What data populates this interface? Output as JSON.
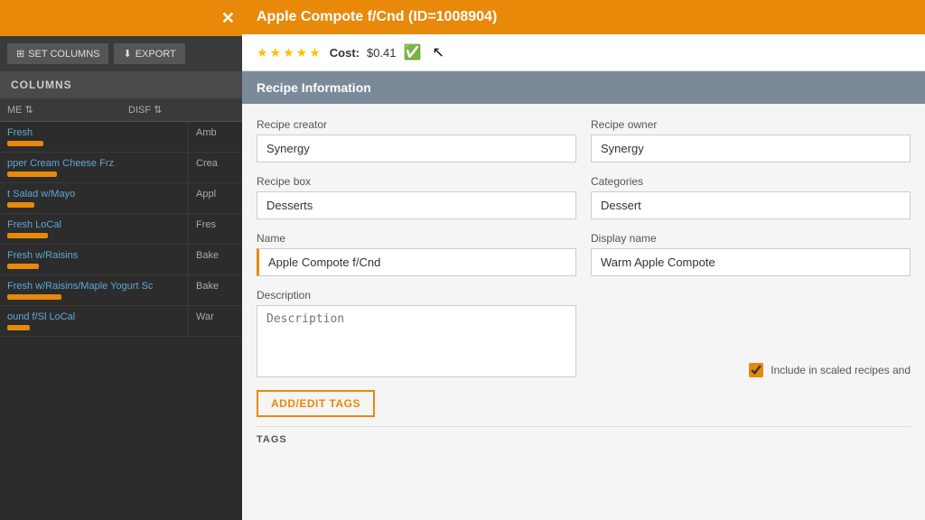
{
  "leftPanel": {
    "closeBtn": "✕",
    "toolbar": {
      "setColumnsLabel": "SET COLUMNS",
      "exportLabel": "EXPORT"
    },
    "columnsHeader": "COLUMNS",
    "columnHeaders": {
      "name": "ME",
      "display": "DISF"
    },
    "rows": [
      {
        "name": "Fresh",
        "display": "Amb",
        "barWidth": 40
      },
      {
        "name": "pper Cream Cheese Frz",
        "display": "Crea",
        "barWidth": 55
      },
      {
        "name": "t Salad w/Mayo",
        "display": "Appl",
        "barWidth": 30
      },
      {
        "name": "Fresh LoCal",
        "display": "Fres",
        "barWidth": 45
      },
      {
        "name": "Fresh w/Raisins",
        "display": "Bake",
        "barWidth": 35
      },
      {
        "name": "Fresh w/Raisins/Maple Yogurt Sc",
        "display": "Bake",
        "barWidth": 60
      },
      {
        "name": "ound f/Sl LoCal",
        "display": "War",
        "barWidth": 25
      }
    ]
  },
  "modal": {
    "title": "Apple Compote f/Cnd (ID=1008904)",
    "stars": "★★★★★",
    "costLabel": "Cost:",
    "costValue": "$0.41",
    "sectionTitle": "Recipe Information",
    "fields": {
      "recipeCreatorLabel": "Recipe creator",
      "recipeCreatorValue": "Synergy",
      "recipeOwnerLabel": "Recipe owner",
      "recipeOwnerValue": "Synergy",
      "recipeBoxLabel": "Recipe box",
      "recipeBoxValue": "Desserts",
      "categoriesLabel": "Categories",
      "categoriesValue": "Dessert",
      "nameLabel": "Name",
      "nameValue": "Apple Compote f/Cnd",
      "displayNameLabel": "Display name",
      "displayNameValue": "Warm Apple Compote",
      "descriptionLabel": "Description",
      "descriptionPlaceholder": "Description",
      "includeInScaledLabel": "Include in scaled recipes and",
      "addTagsLabel": "ADD/EDIT TAGS",
      "tagsLabel": "TAGS"
    }
  }
}
